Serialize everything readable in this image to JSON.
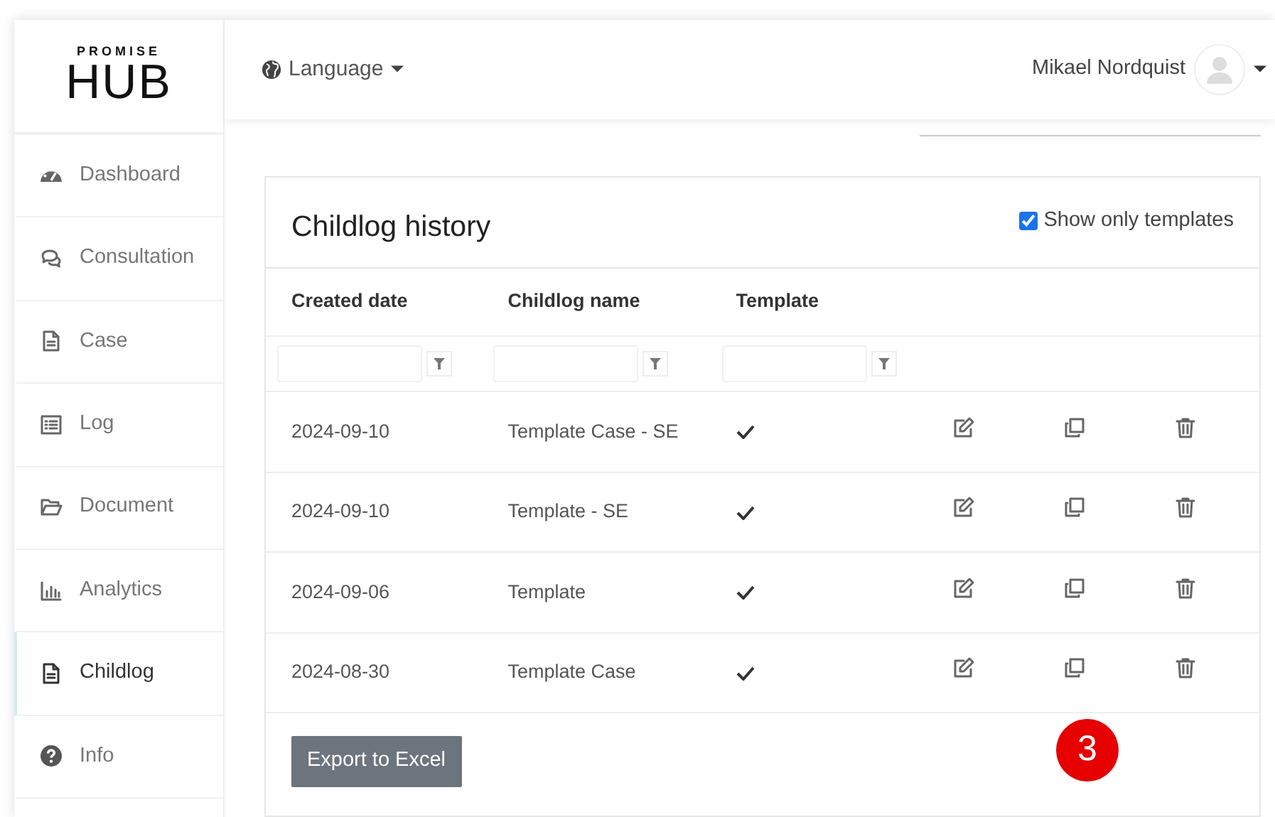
{
  "brand": {
    "small": "PROMISE",
    "large": "HUB"
  },
  "topbar": {
    "language": "Language",
    "user": "Mikael Nordquist"
  },
  "sidebar": {
    "items": [
      {
        "label": "Dashboard",
        "kind": "gauge",
        "selected": false
      },
      {
        "label": "Consultation",
        "kind": "chat",
        "selected": false
      },
      {
        "label": "Case",
        "kind": "file",
        "selected": false
      },
      {
        "label": "Log",
        "kind": "list",
        "selected": false
      },
      {
        "label": "Document",
        "kind": "folder",
        "selected": false
      },
      {
        "label": "Analytics",
        "kind": "chart",
        "selected": false
      },
      {
        "label": "Childlog",
        "kind": "file",
        "selected": true
      },
      {
        "label": "Info",
        "kind": "help",
        "selected": false
      }
    ]
  },
  "card": {
    "title": "Childlog history",
    "show_only_templates": {
      "label": "Show only templates",
      "checked": true
    },
    "table": {
      "columns": [
        "Created date",
        "Childlog name",
        "Template"
      ],
      "rows": [
        {
          "created": "2024-09-10",
          "name": "Template Case - SE",
          "template": true
        },
        {
          "created": "2024-09-10",
          "name": "Template - SE",
          "template": true
        },
        {
          "created": "2024-09-06",
          "name": "Template",
          "template": true
        },
        {
          "created": "2024-08-30",
          "name": "Template Case",
          "template": true
        }
      ]
    },
    "export_button": "Export to Excel"
  },
  "step_badge": "3"
}
